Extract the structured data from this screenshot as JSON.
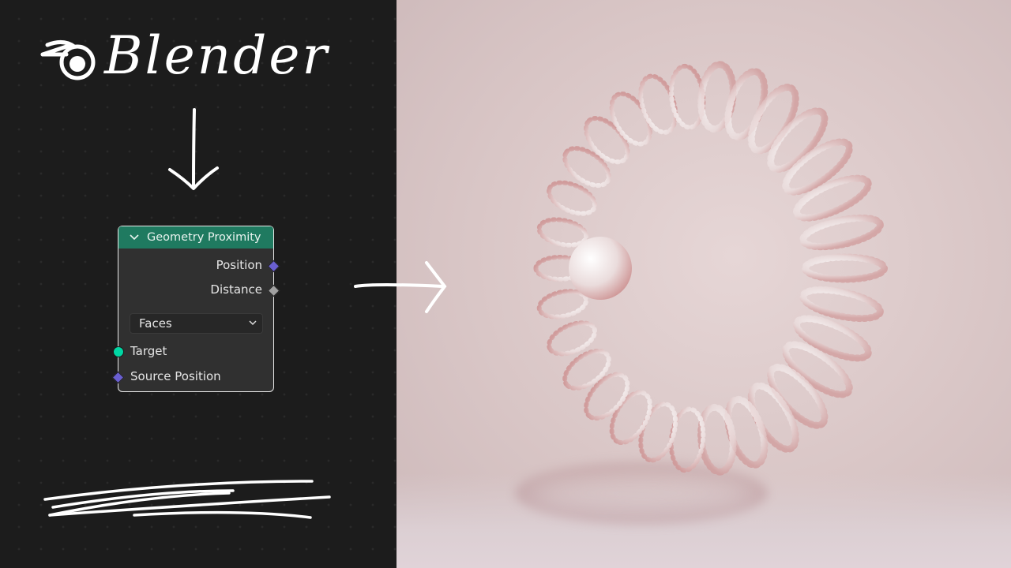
{
  "brand": {
    "name": "Blender",
    "logo_icon": "blender-logo-icon"
  },
  "node": {
    "title": "Geometry Proximity",
    "header_color": "#1f7a60",
    "outputs": [
      {
        "label": "Position",
        "socket_type": "vector",
        "socket_color": "#6a5fd1"
      },
      {
        "label": "Distance",
        "socket_type": "float",
        "socket_color": "#a1a1a1"
      }
    ],
    "mode_dropdown": {
      "selected": "Faces"
    },
    "inputs": [
      {
        "label": "Target",
        "socket_type": "geometry",
        "socket_color": "#00d6a3"
      },
      {
        "label": "Source Position",
        "socket_type": "vector",
        "socket_color": "#6a5fd1"
      }
    ]
  },
  "render": {
    "description": "Pearl-like helical torus of beads with a faceted icosphere, pink studio background"
  }
}
